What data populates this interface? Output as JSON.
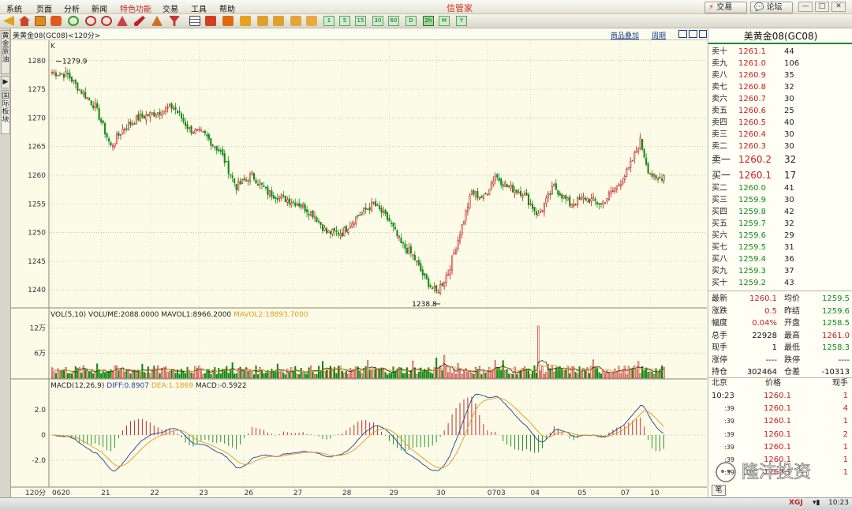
{
  "menubar": {
    "items": [
      "系统",
      "页面",
      "分析",
      "新闻",
      "特色功能",
      "交易",
      "工具",
      "帮助"
    ],
    "hot_index": 4,
    "title": "信管家",
    "trade_label": "交易",
    "forum_label": "论坛"
  },
  "leftbar": {
    "tabs": [
      "黄金原油",
      "国际板块"
    ],
    "arrow": "▶"
  },
  "chart_header": {
    "title": "美黄金08(GC08)<120分>",
    "overlay_label": "商品叠加",
    "period_label": "周期"
  },
  "colors": {
    "up": "#c01818",
    "down": "#138a13",
    "bg": "#fbfbe8",
    "ma1": "#1f3fa0",
    "ma2": "#e39a1b"
  },
  "chart_data": [
    {
      "type": "candlestick",
      "y_ticks": [
        1280,
        1275,
        1270,
        1265,
        1260,
        1255,
        1250,
        1245,
        1240
      ],
      "ylim": [
        1237,
        1283
      ],
      "marker": "K",
      "annotations": [
        {
          "text": "1279.9",
          "value": 1279.9
        },
        {
          "text": "1238.8",
          "value": 1238.8
        }
      ],
      "x_labels": [
        "0620",
        "21",
        "22",
        "23",
        "26",
        "27",
        "28",
        "29",
        "30",
        "0703",
        "04",
        "05",
        "07",
        "10"
      ],
      "anchors": [
        [
          0,
          1278
        ],
        [
          8,
          1277.5
        ],
        [
          14,
          1275
        ],
        [
          22,
          1272
        ],
        [
          30,
          1265
        ],
        [
          36,
          1268
        ],
        [
          44,
          1270
        ],
        [
          54,
          1271
        ],
        [
          62,
          1272
        ],
        [
          70,
          1268
        ],
        [
          78,
          1267
        ],
        [
          86,
          1264
        ],
        [
          94,
          1258
        ],
        [
          102,
          1260
        ],
        [
          110,
          1257
        ],
        [
          118,
          1256
        ],
        [
          126,
          1255
        ],
        [
          134,
          1253
        ],
        [
          140,
          1250
        ],
        [
          148,
          1250
        ],
        [
          156,
          1253
        ],
        [
          164,
          1255
        ],
        [
          172,
          1252
        ],
        [
          178,
          1248
        ],
        [
          184,
          1246
        ],
        [
          190,
          1242
        ],
        [
          196,
          1239.5
        ],
        [
          202,
          1243
        ],
        [
          208,
          1250
        ],
        [
          214,
          1257
        ],
        [
          220,
          1256
        ],
        [
          226,
          1260
        ],
        [
          232,
          1258
        ],
        [
          240,
          1257
        ],
        [
          248,
          1253
        ],
        [
          256,
          1258
        ],
        [
          264,
          1255
        ],
        [
          272,
          1256
        ],
        [
          280,
          1255
        ],
        [
          288,
          1258
        ],
        [
          294,
          1261
        ],
        [
          300,
          1266
        ],
        [
          304,
          1261
        ],
        [
          308,
          1259
        ],
        [
          312,
          1260
        ]
      ],
      "count": 313
    },
    {
      "type": "bar",
      "title": "VOL(5,10) VOLUME:2088.0000",
      "series": [
        {
          "name": "MAVOL1:8966.2000"
        },
        {
          "name": "MAVOL2:18893.7000"
        }
      ],
      "y_ticks": [
        "12万",
        "6万"
      ]
    },
    {
      "type": "macd",
      "title": "MACD(12,26,9)",
      "series": [
        {
          "name": "DIFF:0.8907"
        },
        {
          "name": "DEA:1.1869"
        },
        {
          "name": "MACD:-0.5922"
        }
      ],
      "y_ticks": [
        "2.0",
        "0",
        "-2.0"
      ]
    }
  ],
  "orderbook": {
    "product": "美黄金08(GC08)",
    "asks": [
      [
        "卖十",
        "1261.1",
        "44"
      ],
      [
        "卖九",
        "1261.0",
        "106"
      ],
      [
        "卖八",
        "1260.9",
        "35"
      ],
      [
        "卖七",
        "1260.8",
        "32"
      ],
      [
        "卖六",
        "1260.7",
        "30"
      ],
      [
        "卖五",
        "1260.6",
        "25"
      ],
      [
        "卖四",
        "1260.5",
        "40"
      ],
      [
        "卖三",
        "1260.4",
        "30"
      ],
      [
        "卖二",
        "1260.3",
        "30"
      ],
      [
        "卖一",
        "1260.2",
        "32"
      ]
    ],
    "bids": [
      [
        "买一",
        "1260.1",
        "17"
      ],
      [
        "买二",
        "1260.0",
        "41"
      ],
      [
        "买三",
        "1259.9",
        "30"
      ],
      [
        "买四",
        "1259.8",
        "42"
      ],
      [
        "买五",
        "1259.7",
        "32"
      ],
      [
        "买六",
        "1259.6",
        "29"
      ],
      [
        "买七",
        "1259.5",
        "31"
      ],
      [
        "买八",
        "1259.4",
        "36"
      ],
      [
        "买九",
        "1259.3",
        "37"
      ],
      [
        "买十",
        "1259.2",
        "43"
      ]
    ]
  },
  "stats": [
    [
      "最新",
      "1260.1",
      "均价",
      "1259.5"
    ],
    [
      "涨跌",
      "0.5",
      "昨结",
      "1259.6"
    ],
    [
      "幅度",
      "0.04%",
      "开盘",
      "1258.5"
    ],
    [
      "总手",
      "22928",
      "最高",
      "1261.0"
    ],
    [
      "现手",
      "1",
      "最低",
      "1258.3"
    ],
    [
      "涨停",
      "----",
      "跌停",
      "----"
    ],
    [
      "持仓",
      "302464",
      "仓差",
      "-10313"
    ]
  ],
  "ticks": {
    "headers": [
      "北京",
      "价格",
      "现手"
    ],
    "rows": [
      [
        "10:23",
        "1260.1",
        "1"
      ],
      [
        ":39",
        "1260.1",
        "4"
      ],
      [
        ":39",
        "1260.1",
        "1"
      ],
      [
        ":39",
        "1260.1",
        "2"
      ],
      [
        ":39",
        "1260.1",
        "1"
      ],
      [
        ":39",
        "1260.1",
        "1"
      ],
      [
        ":39",
        "1260.1",
        "1"
      ]
    ],
    "footer": "笔"
  },
  "watermark": {
    "text": "隆沣投资"
  },
  "statusbar": {
    "time": "10:23",
    "brand": "XGJ",
    "period_label": "120分"
  }
}
